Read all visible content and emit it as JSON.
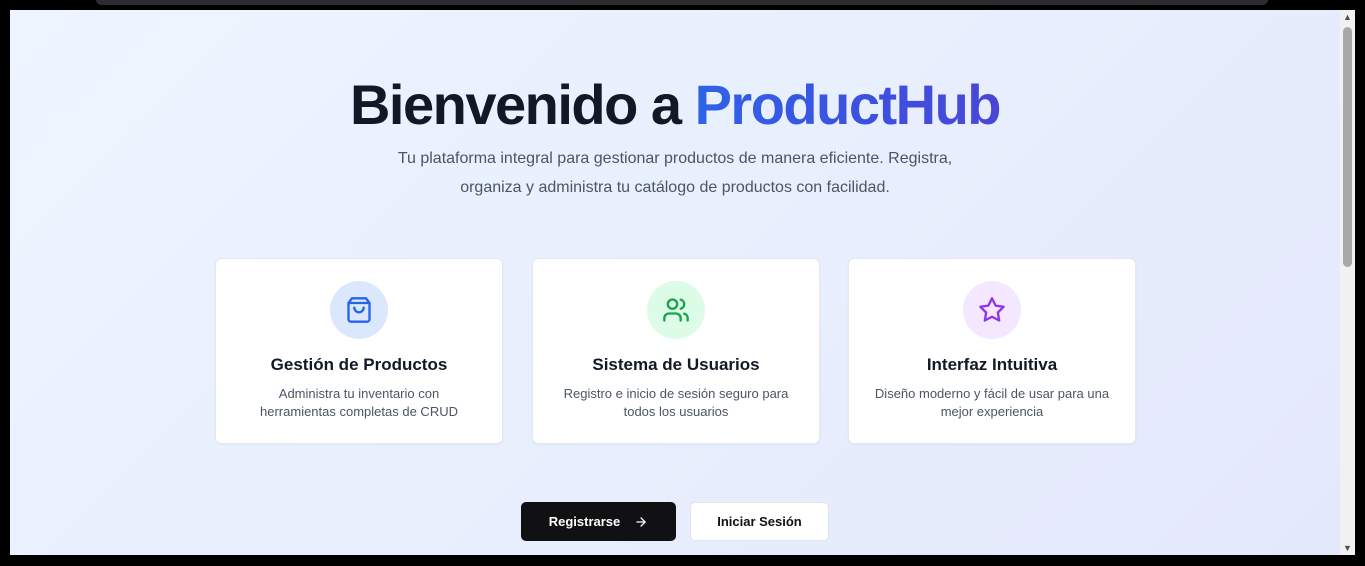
{
  "hero": {
    "title_prefix": "Bienvenido a ",
    "title_brand": "ProductHub",
    "subtitle_line1": "Tu plataforma integral para gestionar productos de manera eficiente. Registra,",
    "subtitle_line2": "organiza y administra tu catálogo de productos con facilidad."
  },
  "features": [
    {
      "icon": "shopping-bag-icon",
      "title": "Gestión de Productos",
      "desc_line1": "Administra tu inventario con",
      "desc_line2": "herramientas completas de CRUD",
      "icon_bg": "#dbe7fd",
      "icon_color": "#2563eb"
    },
    {
      "icon": "users-icon",
      "title": "Sistema de Usuarios",
      "desc_line1": "Registro e inicio de sesión seguro para",
      "desc_line2": "todos los usuarios",
      "icon_bg": "#dcfce7",
      "icon_color": "#16a34a"
    },
    {
      "icon": "star-icon",
      "title": "Interfaz Intuitiva",
      "desc_line1": "Diseño moderno y fácil de usar para una",
      "desc_line2": "mejor experiencia",
      "icon_bg": "#f3e8ff",
      "icon_color": "#9333ea"
    }
  ],
  "actions": {
    "register_label": "Registrarse",
    "login_label": "Iniciar Sesión"
  }
}
